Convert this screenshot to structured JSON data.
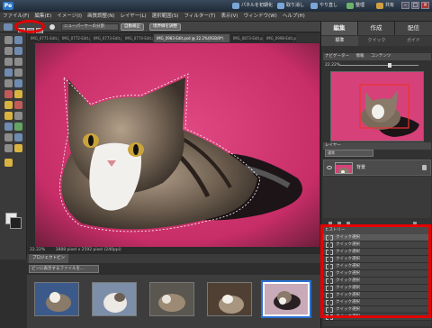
{
  "app": {
    "logo_text": "Pe",
    "title_buttons": [
      {
        "label": "パネルを初期化"
      },
      {
        "label": "取り消し"
      },
      {
        "label": "やり直し"
      },
      {
        "label": "整理"
      },
      {
        "label": "共有"
      }
    ]
  },
  "menu": [
    "ファイル(F)",
    "編集(E)",
    "イメージ(I)",
    "画質調整(N)",
    "レイヤー(L)",
    "選択範囲(S)",
    "フィルター(T)",
    "表示(V)",
    "ウィンドウ(W)",
    "ヘルプ(H)"
  ],
  "options": {
    "mode_field": "ニューパーヤーの分割",
    "auto_enhance": "自動補正",
    "refine_edge": "境界線を調整"
  },
  "doc_tabs": [
    "IMG_0771-Edit.psd",
    "IMG_0772-Edit.psd",
    "IMG_0773-Edit.psd",
    "IMG_0774-Edit.psd",
    "IMG_0983-Edit.psd @ 22.2%(RGB/8*)",
    "IMG_0873-Edit.psd",
    "IMG_0998-Edit.psd"
  ],
  "status": {
    "zoom": "22.22%",
    "doc_info": "3888 pixel x 2592 pixel (240ppi)"
  },
  "bin": {
    "tab_label": "プロジェクトビン",
    "dropdown": "ビンに表示するファイルを..."
  },
  "right_panel": {
    "mode_tabs": [
      "編集",
      "作成",
      "配信"
    ],
    "sub_tabs": [
      "標準",
      "クイック",
      "ガイド"
    ],
    "navigator_tabs": [
      "ナビゲーター",
      "情報",
      "コンテンツ"
    ],
    "nav_zoom": "22.22%",
    "layers_header": "レイヤー",
    "layer_blend": "通常",
    "layer_name": "背景",
    "history_header": "ヒストリー",
    "history_items": [
      "クイック選択",
      "クイック選択",
      "クイック選択",
      "クイック選択",
      "クイック選択",
      "クイック選択",
      "クイック選択",
      "クイック選択",
      "クイック選択",
      "クイック選択",
      "クイック選択",
      "クイック選択"
    ]
  }
}
